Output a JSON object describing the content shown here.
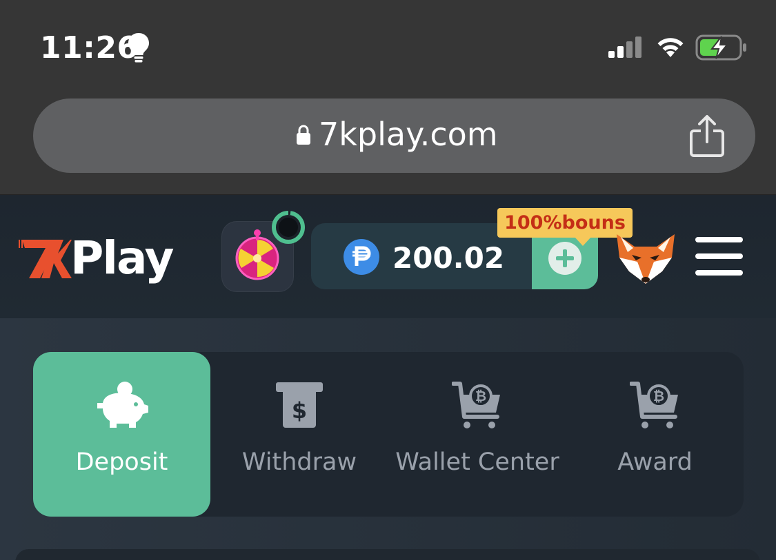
{
  "status_bar": {
    "time": "11:26",
    "icons": [
      "lightbulb-icon",
      "cellular-signal-icon",
      "wifi-icon",
      "battery-charging-icon"
    ]
  },
  "browser": {
    "url": "7kplay.com",
    "icons": [
      "lock-icon",
      "share-icon"
    ]
  },
  "header": {
    "logo_prefix": "7K",
    "logo_suffix": "Play",
    "wheel_icon": "lucky-wheel-icon",
    "timer_icon": "countdown-ring-icon",
    "currency_icon": "peso-icon",
    "balance": "200.02",
    "add_icon": "plus-icon",
    "bonus_badge": "100%bouns",
    "avatar_icon": "fox-avatar-icon",
    "menu_icon": "hamburger-menu-icon"
  },
  "wallet_tabs": [
    {
      "label": "Deposit",
      "icon": "piggy-bank-icon",
      "active": true
    },
    {
      "label": "Withdraw",
      "icon": "cash-withdraw-icon",
      "active": false
    },
    {
      "label": "Wallet Center",
      "icon": "bitcoin-cart-icon",
      "active": false
    },
    {
      "label": "Award",
      "icon": "bitcoin-cart-icon",
      "active": false
    }
  ],
  "colors": {
    "accent": "#5cbd99",
    "logo_orange": "#e8502e",
    "bonus_bg": "#f6c85a",
    "bonus_text": "#c42e16",
    "peso_blue": "#3d8ce6"
  }
}
